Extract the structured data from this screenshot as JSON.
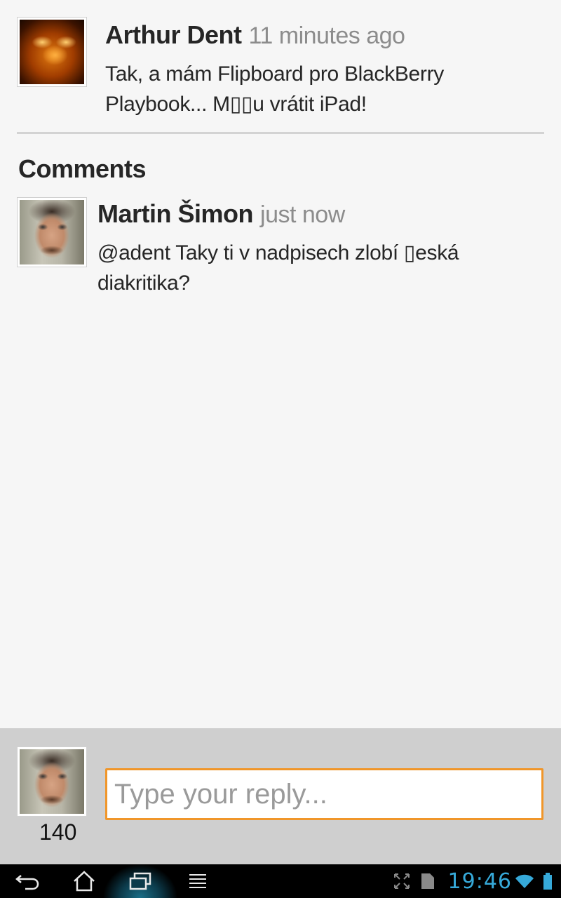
{
  "post": {
    "author": "Arthur Dent",
    "time": "11 minutes ago",
    "text": "Tak, a mám Flipboard pro BlackBerry Playbook... M▯▯u vrátit iPad!"
  },
  "comments": {
    "heading": "Comments",
    "items": [
      {
        "author": "Martin Šimon",
        "time": "just now",
        "text": "@adent Taky ti v nadpisech zlobí ▯eská diakritika?"
      }
    ]
  },
  "reply": {
    "placeholder": "Type your reply...",
    "char_count": "140"
  },
  "status_bar": {
    "time": "19:46",
    "accent_color": "#36a9d9"
  },
  "nav": {
    "icons": [
      "back-icon",
      "home-icon",
      "recent-apps-icon",
      "menu-icon"
    ]
  },
  "colors": {
    "input_border": "#f0962a",
    "reply_bar_bg": "#cfcfcf",
    "page_bg": "#f6f6f6"
  }
}
